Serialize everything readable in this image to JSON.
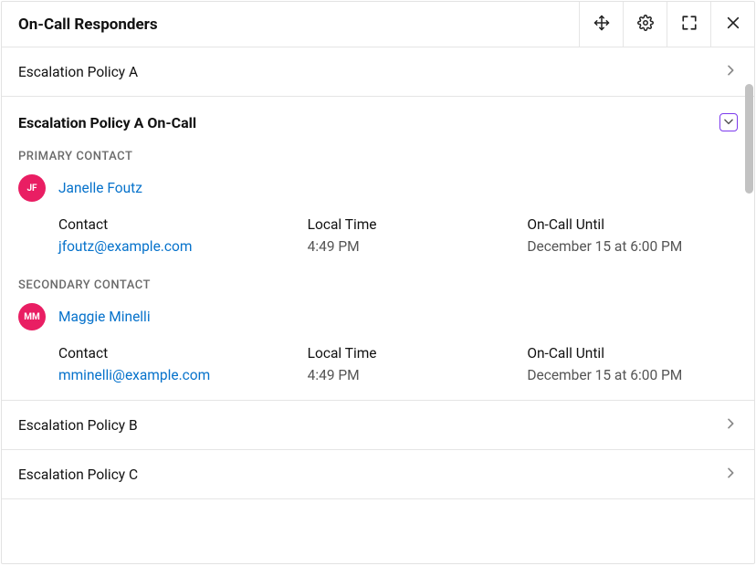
{
  "header": {
    "title": "On-Call Responders"
  },
  "policies": [
    {
      "label": "Escalation Policy A",
      "expanded": false
    },
    {
      "label": "Escalation Policy B",
      "expanded": false
    },
    {
      "label": "Escalation Policy C",
      "expanded": false
    }
  ],
  "expanded_panel": {
    "title": "Escalation Policy A On-Call",
    "primary_section_label": "PRIMARY CONTACT",
    "secondary_section_label": "SECONDARY CONTACT",
    "labels": {
      "contact": "Contact",
      "local_time": "Local Time",
      "until": "On-Call Until"
    },
    "primary": {
      "initials": "JF",
      "name": "Janelle Foutz",
      "email": "jfoutz@example.com",
      "local_time": "4:49 PM",
      "until": "December 15 at 6:00 PM"
    },
    "secondary": {
      "initials": "MM",
      "name": "Maggie Minelli",
      "email": "mminelli@example.com",
      "local_time": "4:49 PM",
      "until": "December 15 at 6:00 PM"
    }
  },
  "colors": {
    "link": "#0672cb",
    "avatar_bg": "#e91e63",
    "accent_border": "#7c3aed"
  }
}
